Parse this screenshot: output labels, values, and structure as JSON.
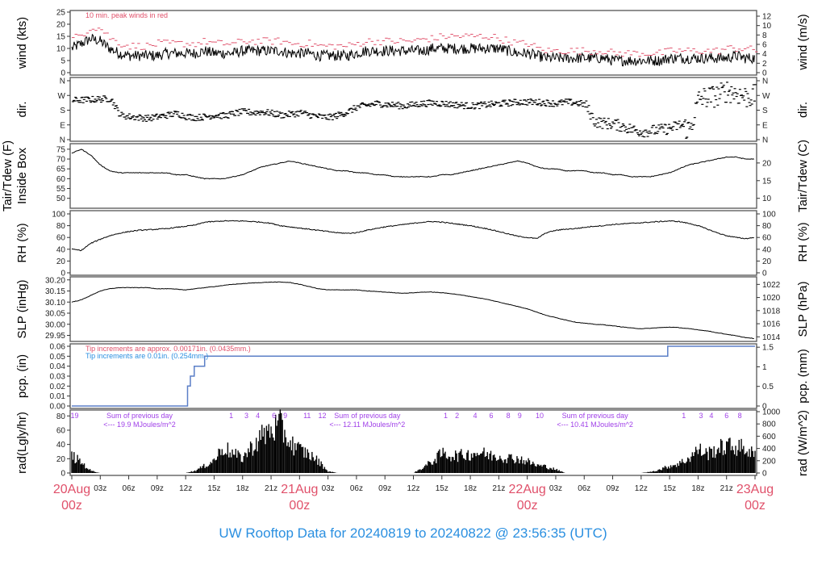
{
  "title": "UW Rooftop Data for 20240819  to  20240822 @ 23:56:35  (UTC)",
  "x_axis": {
    "hours_span": 72,
    "tick_step_hours": 3,
    "tick_labels": [
      "03z",
      "06z",
      "09z",
      "12z",
      "15z",
      "18z",
      "21z",
      "03z",
      "06z",
      "09z",
      "12z",
      "15z",
      "18z",
      "21z",
      "03z",
      "06z",
      "09z",
      "12z",
      "15z",
      "18z",
      "21z"
    ],
    "tick_hours": [
      3,
      6,
      9,
      12,
      15,
      18,
      21,
      27,
      30,
      33,
      36,
      39,
      42,
      45,
      51,
      54,
      57,
      60,
      63,
      66,
      69
    ],
    "day_labels": [
      {
        "hour": 0,
        "day": "20Aug",
        "time": "00z"
      },
      {
        "hour": 24,
        "day": "21Aug",
        "time": "00z"
      },
      {
        "hour": 48,
        "day": "22Aug",
        "time": "00z"
      },
      {
        "hour": 72,
        "day": "23Aug",
        "time": "00z"
      }
    ],
    "day_color": "#e0506a"
  },
  "chart_data": [
    {
      "id": "wind",
      "type": "line",
      "ylabel": "wind (kts)",
      "ylabel_right": "wind (m/s)",
      "ylim": [
        0,
        25
      ],
      "yticks": [
        0,
        5,
        10,
        15,
        20,
        25
      ],
      "yticks_right": [
        0,
        2,
        4,
        6,
        8,
        10,
        12
      ],
      "right_factor": 1.944,
      "annotation": "10 min. peak winds in red",
      "annotation_color": "#e0506a",
      "series": [
        {
          "name": "mean wind",
          "color": "#000000",
          "values": [
            10,
            12,
            14,
            13,
            10,
            8,
            7,
            7,
            7,
            7,
            8,
            8,
            8,
            8,
            9,
            8,
            8,
            8,
            9,
            9,
            9,
            9,
            9,
            8,
            8,
            8,
            7,
            7,
            7,
            7,
            8,
            9,
            9,
            9,
            9,
            9,
            9,
            9,
            10,
            10,
            10,
            10,
            10,
            10,
            10,
            10,
            9,
            8,
            8,
            7,
            6,
            6,
            6,
            6,
            6,
            6,
            6,
            5,
            5,
            5,
            5,
            5,
            5,
            6,
            6,
            6,
            6,
            6,
            6,
            6,
            7,
            6,
            6
          ]
        },
        {
          "name": "10 min. peak winds",
          "color": "#e0506a",
          "style": "dashes",
          "values": [
            14,
            16,
            19,
            18,
            14,
            12,
            11,
            11,
            11,
            12,
            12,
            12,
            12,
            12,
            13,
            12,
            12,
            12,
            13,
            13,
            13,
            13,
            13,
            12,
            12,
            12,
            11,
            11,
            11,
            11,
            12,
            13,
            13,
            13,
            13,
            13,
            13,
            14,
            14,
            15,
            15,
            15,
            15,
            15,
            15,
            14,
            13,
            12,
            12,
            10,
            9,
            9,
            9,
            9,
            9,
            9,
            9,
            8,
            8,
            8,
            8,
            8,
            8,
            9,
            9,
            9,
            9,
            9,
            9,
            10,
            10,
            10,
            9
          ]
        }
      ]
    },
    {
      "id": "dir",
      "type": "scatter",
      "ylabel": "dir.",
      "ylabel_right": "dir.",
      "ylim": [
        0,
        360
      ],
      "yticks": [
        0,
        90,
        180,
        270,
        360
      ],
      "ytick_labels": [
        "N",
        "E",
        "S",
        "W",
        "N"
      ],
      "series": [
        {
          "name": "wind direction (deg)",
          "color": "#000000",
          "values": [
            240,
            242,
            245,
            248,
            250,
            150,
            140,
            135,
            130,
            140,
            150,
            160,
            140,
            135,
            140,
            150,
            145,
            160,
            170,
            165,
            170,
            160,
            150,
            155,
            165,
            150,
            140,
            135,
            150,
            170,
            200,
            210,
            220,
            215,
            210,
            205,
            215,
            220,
            225,
            220,
            215,
            210,
            205,
            210,
            215,
            220,
            225,
            230,
            230,
            228,
            225,
            220,
            230,
            225,
            215,
            110,
            100,
            95,
            80,
            60,
            50,
            55,
            60,
            70,
            90,
            60,
            250,
            260,
            270,
            300,
            280,
            260,
            270
          ]
        }
      ]
    },
    {
      "id": "tair",
      "type": "line",
      "ylabel": "Tair/Tdew (F)",
      "ylabel2": "Inside Box",
      "ylabel_right": "Tair/Tdew (C)",
      "ylim": [
        47,
        77
      ],
      "yticks": [
        50,
        55,
        60,
        65,
        70,
        75
      ],
      "yticks_right": [
        10,
        15,
        20
      ],
      "series": [
        {
          "name": "Tair",
          "color": "#000000",
          "values": [
            73,
            75,
            72,
            67,
            64,
            63,
            63,
            63,
            63,
            63,
            63,
            62,
            62,
            61,
            60,
            60,
            60,
            61,
            62,
            64,
            66,
            67,
            68,
            69,
            68,
            67,
            66,
            65,
            64,
            64,
            63,
            63,
            62,
            62,
            61,
            61,
            61,
            61,
            61,
            62,
            62,
            63,
            64,
            65,
            66,
            67,
            68,
            69,
            68,
            66,
            65,
            65,
            64,
            64,
            64,
            63,
            63,
            62,
            62,
            61,
            61,
            61,
            62,
            63,
            65,
            67,
            68,
            69,
            70,
            71,
            71,
            70,
            70
          ]
        }
      ]
    },
    {
      "id": "rh",
      "type": "line",
      "ylabel": "RH (%)",
      "ylabel_right": "RH (%)",
      "ylim": [
        0,
        100
      ],
      "yticks": [
        0,
        20,
        40,
        60,
        80,
        100
      ],
      "series": [
        {
          "name": "RH",
          "color": "#000000",
          "values": [
            40,
            38,
            50,
            57,
            63,
            67,
            70,
            72,
            73,
            74,
            75,
            77,
            79,
            81,
            86,
            87,
            88,
            88,
            88,
            87,
            86,
            84,
            80,
            78,
            76,
            74,
            72,
            70,
            68,
            67,
            68,
            72,
            75,
            78,
            80,
            82,
            84,
            86,
            87,
            86,
            84,
            82,
            80,
            77,
            74,
            70,
            66,
            62,
            60,
            58,
            68,
            72,
            74,
            75,
            77,
            79,
            80,
            82,
            83,
            84,
            85,
            86,
            87,
            88,
            87,
            84,
            80,
            74,
            68,
            63,
            60,
            58,
            60
          ]
        }
      ]
    },
    {
      "id": "slp",
      "type": "line",
      "ylabel": "SLP (inHg)",
      "ylabel_right": "SLP (hPa)",
      "ylim": [
        29.93,
        30.21
      ],
      "yticks": [
        29.95,
        30.0,
        30.05,
        30.1,
        30.15,
        30.2
      ],
      "ytick_labels": [
        "29.95",
        "30.00",
        "30.05",
        "30.10",
        "30.15",
        "30.20"
      ],
      "yticks_right": [
        1014,
        1016,
        1018,
        1020,
        1022
      ],
      "right_factor": 0.02953,
      "series": [
        {
          "name": "SLP",
          "color": "#000000",
          "values": [
            30.1,
            30.11,
            30.13,
            30.15,
            30.16,
            30.165,
            30.165,
            30.165,
            30.165,
            30.16,
            30.16,
            30.158,
            30.155,
            30.16,
            30.165,
            30.17,
            30.175,
            30.18,
            30.183,
            30.186,
            30.188,
            30.19,
            30.19,
            30.188,
            30.18,
            30.17,
            30.16,
            30.155,
            30.155,
            30.155,
            30.155,
            30.15,
            30.148,
            30.145,
            30.142,
            30.14,
            30.142,
            30.145,
            30.145,
            30.142,
            30.138,
            30.132,
            30.125,
            30.118,
            30.11,
            30.1,
            30.09,
            30.08,
            30.07,
            30.055,
            30.04,
            30.03,
            30.02,
            30.01,
            30.005,
            30.0,
            29.998,
            29.993,
            29.988,
            29.983,
            29.98,
            29.982,
            29.985,
            29.987,
            29.985,
            29.98,
            29.975,
            29.97,
            29.962,
            29.955,
            29.948,
            29.94,
            29.935
          ]
        }
      ]
    },
    {
      "id": "pcp",
      "type": "line",
      "ylabel": "pcp. (in)",
      "ylabel_right": "pcp. (mm)",
      "ylim": [
        0,
        0.06
      ],
      "yticks": [
        0,
        0.01,
        0.02,
        0.03,
        0.04,
        0.05,
        0.06
      ],
      "ytick_labels": [
        "0.00",
        "0.01",
        "0.02",
        "0.03",
        "0.04",
        "0.05",
        "0.06"
      ],
      "yticks_right": [
        0,
        0.5,
        1,
        1.5
      ],
      "right_factor": 0.03937,
      "annotations": [
        {
          "text": "Tip increments are approx. 0.00171in. (0.0435mm.)",
          "color": "#e0506a"
        },
        {
          "text": "Tip increments are 0.01in. (0.254mm.)",
          "color": "#2a8fe0"
        }
      ],
      "series": [
        {
          "name": "cumulative precipitation",
          "color": "#5b7fc7",
          "style": "step",
          "points": [
            [
              0,
              0
            ],
            [
              12.2,
              0
            ],
            [
              12.2,
              0.02
            ],
            [
              12.5,
              0.02
            ],
            [
              12.5,
              0.03
            ],
            [
              12.9,
              0.03
            ],
            [
              12.9,
              0.04
            ],
            [
              14.0,
              0.04
            ],
            [
              14.0,
              0.05
            ],
            [
              62.8,
              0.05
            ],
            [
              62.8,
              0.06
            ],
            [
              72,
              0.06
            ]
          ]
        }
      ]
    },
    {
      "id": "rad",
      "type": "bar",
      "ylabel": "rad(Lgly/hr)",
      "ylabel_right": "rad (W/m^2)",
      "ylim": [
        0,
        86
      ],
      "yticks": [
        0,
        20,
        40,
        60,
        80
      ],
      "yticks_right": [
        0,
        200,
        400,
        600,
        800,
        1000
      ],
      "right_factor": 0.08598,
      "series": [
        {
          "name": "solar radiation (W/m^2)",
          "color": "#000000",
          "values": [
            300,
            180,
            40,
            0,
            0,
            0,
            0,
            0,
            0,
            0,
            0,
            0,
            0,
            40,
            120,
            220,
            450,
            320,
            260,
            450,
            620,
            750,
            800,
            520,
            400,
            320,
            200,
            30,
            0,
            0,
            0,
            0,
            0,
            0,
            0,
            0,
            0,
            90,
            200,
            330,
            300,
            300,
            330,
            350,
            300,
            290,
            260,
            250,
            200,
            130,
            110,
            60,
            0,
            0,
            0,
            0,
            0,
            0,
            0,
            0,
            0,
            20,
            60,
            120,
            160,
            250,
            400,
            330,
            410,
            460,
            450,
            420,
            300
          ]
        }
      ],
      "solar_hours": [
        {
          "label": "19",
          "hour": 0.3
        },
        {
          "label": "1",
          "hour": 16.8
        },
        {
          "label": "3",
          "hour": 18.4
        },
        {
          "label": "4",
          "hour": 19.6
        },
        {
          "label": "6",
          "hour": 21.3
        },
        {
          "label": "9",
          "hour": 22.5
        },
        {
          "label": "11",
          "hour": 24.8
        },
        {
          "label": "12",
          "hour": 26.4
        },
        {
          "label": "1",
          "hour": 39.4
        },
        {
          "label": "2",
          "hour": 40.6
        },
        {
          "label": "4",
          "hour": 42.5
        },
        {
          "label": "6",
          "hour": 44.2
        },
        {
          "label": "8",
          "hour": 46.0
        },
        {
          "label": "9",
          "hour": 47.2
        },
        {
          "label": "10",
          "hour": 49.3
        },
        {
          "label": "1",
          "hour": 64.5
        },
        {
          "label": "3",
          "hour": 66.3
        },
        {
          "label": "4",
          "hour": 67.4
        },
        {
          "label": "6",
          "hour": 69.0
        },
        {
          "label": "8",
          "hour": 70.4
        }
      ],
      "daily_sums": [
        {
          "line1": "Sum of previous day",
          "line2": "<--- 19.9 MJoules/m^2",
          "hour": 0
        },
        {
          "line1": "Sum of previous day",
          "line2": "<--- 12.11 MJoules/m^2",
          "hour": 24
        },
        {
          "line1": "Sum of previous day",
          "line2": "<--- 10.41 MJoules/m^2",
          "hour": 48
        }
      ],
      "annotation_color": "#a040e8"
    }
  ]
}
